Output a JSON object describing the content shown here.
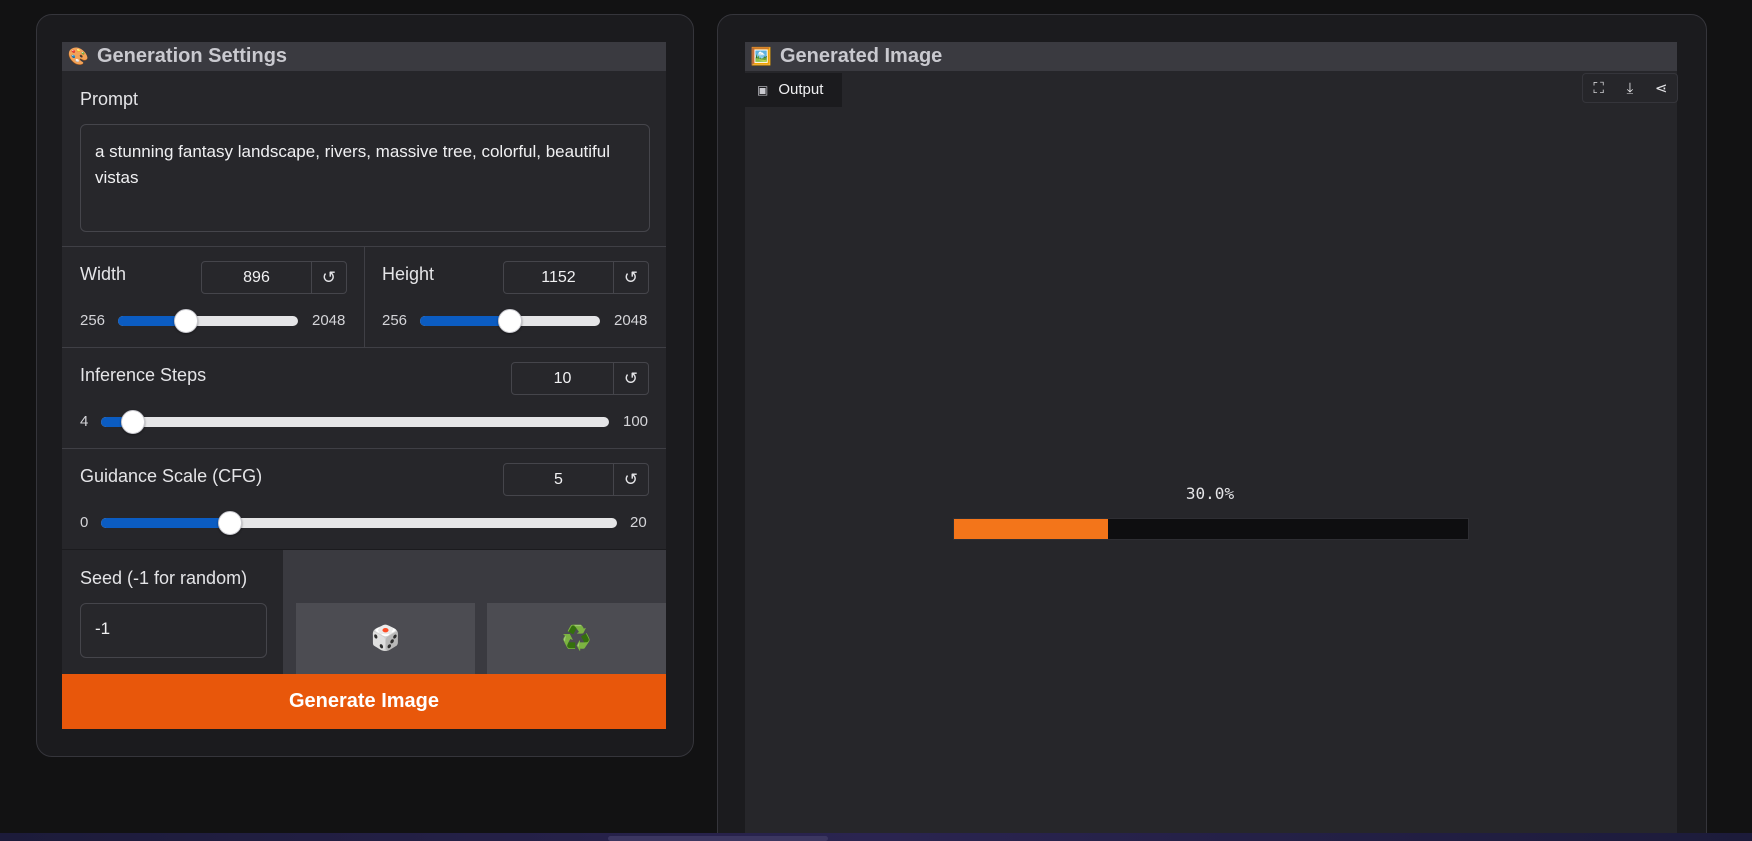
{
  "settings_panel": {
    "emoji": "🎨",
    "title": "Generation Settings",
    "prompt": {
      "label": "Prompt",
      "value": "a stunning fantasy landscape, rivers, massive tree, colorful, beautiful vistas"
    },
    "width": {
      "label": "Width",
      "value": "896",
      "min": "256",
      "max": "2048",
      "fraction": 0.378
    },
    "height": {
      "label": "Height",
      "value": "1152",
      "min": "256",
      "max": "2048",
      "fraction": 0.5
    },
    "steps": {
      "label": "Inference Steps",
      "value": "10",
      "min": "4",
      "max": "100",
      "fraction": 0.0625
    },
    "cfg": {
      "label": "Guidance Scale (CFG)",
      "value": "5",
      "min": "0",
      "max": "20",
      "fraction": 0.25
    },
    "reset_glyph": "↺",
    "seed": {
      "label": "Seed (-1 for random)",
      "value": "-1"
    },
    "random_button_glyph": "🎲",
    "reuse_button_glyph": "♻️",
    "generate_label": "Generate Image",
    "accent": "#e8570b",
    "slider_color": "#0b5cc2"
  },
  "output_panel": {
    "emoji": "🖼️",
    "title": "Generated Image",
    "tab_label": "Output",
    "progress_text": "30.0%",
    "progress_fraction": 0.3,
    "progress_color": "#f3751a",
    "toolbar_icons": [
      "fullscreen-icon",
      "download-icon",
      "share-icon"
    ]
  }
}
